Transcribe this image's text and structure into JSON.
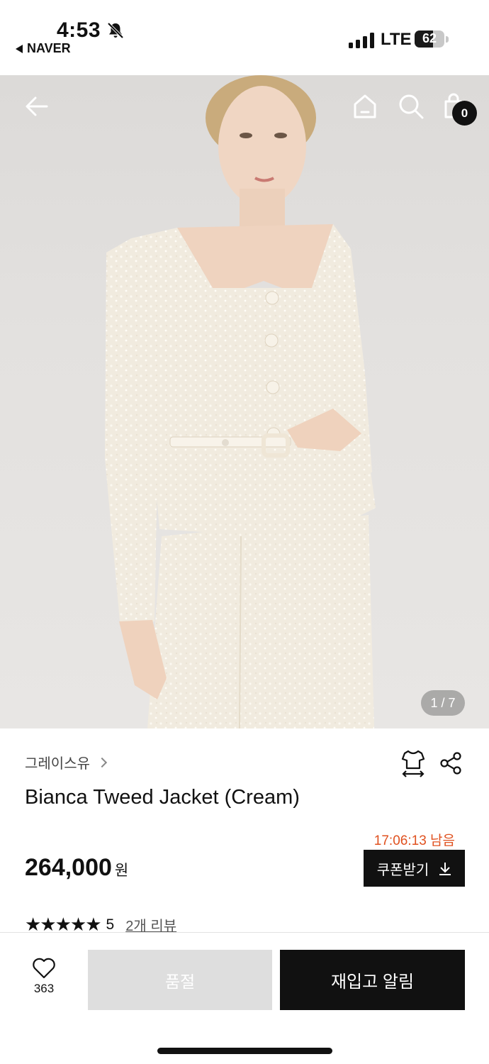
{
  "status_bar": {
    "time": "4:53",
    "back_app": "NAVER",
    "network": "LTE",
    "battery": "62",
    "battery_level": 0.62
  },
  "hero": {
    "page_indicator": "1 / 7",
    "cart_count": "0"
  },
  "product": {
    "brand": "그레이스유",
    "title": "Bianca Tweed Jacket (Cream)",
    "countdown": "17:06:13 남음",
    "price": "264,000",
    "currency": "원",
    "coupon_label": "쿠폰받기",
    "stars": "★★★★★",
    "rating": "5",
    "reviews": "2개 리뷰"
  },
  "bottom_bar": {
    "wish_count": "363",
    "soldout_label": "품절",
    "restock_label": "재입고 알림"
  },
  "colors": {
    "accent_countdown": "#e0511f",
    "primary_button": "#111111",
    "disabled_button": "#dedede"
  },
  "icons": [
    "bell-slash-icon",
    "back-arrow-icon",
    "home-icon",
    "search-icon",
    "cart-icon",
    "size-guide-icon",
    "share-icon",
    "heart-icon",
    "download-icon",
    "chevron-right-icon"
  ]
}
